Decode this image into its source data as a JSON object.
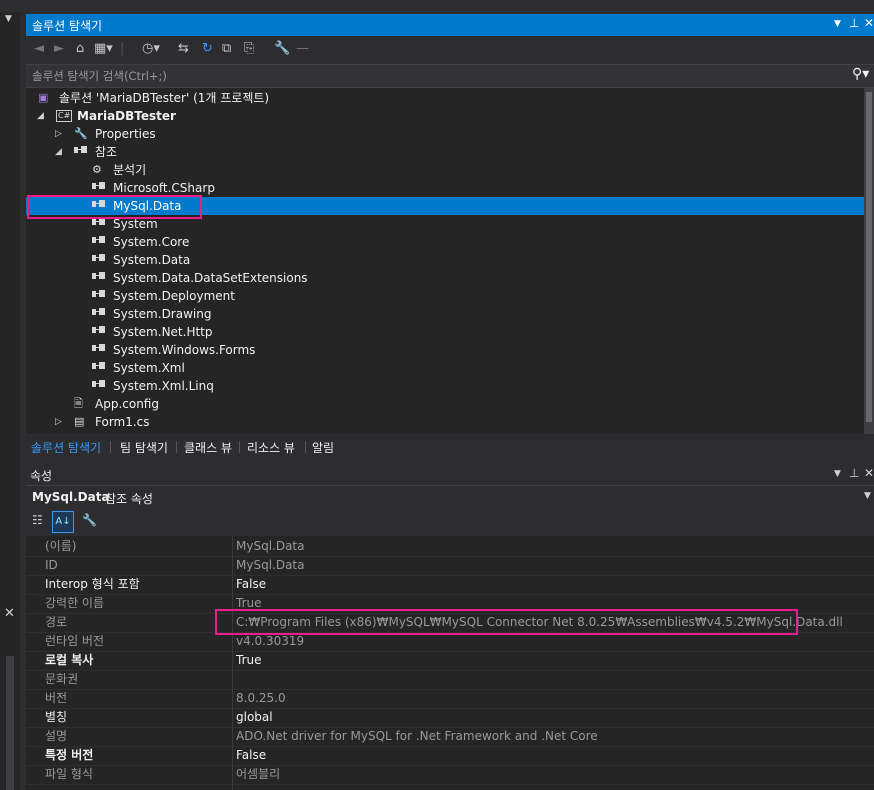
{
  "solution_explorer": {
    "title": "솔루션 탐색기",
    "search_placeholder": "솔루션 탐색기 검색(Ctrl+;)",
    "tree": [
      {
        "label": "솔루션 'MariaDBTester' (1개 프로젝트)",
        "icon": "solution-icon",
        "level": 0
      },
      {
        "label": "MariaDBTester",
        "icon": "csharp-project-icon",
        "level": 0,
        "expanded": true,
        "bold": true
      },
      {
        "label": "Properties",
        "icon": "wrench-icon",
        "level": 1,
        "collapsed": true
      },
      {
        "label": "참조",
        "icon": "reference-icon",
        "level": 1,
        "expanded": true
      },
      {
        "label": "분석기",
        "icon": "analyzer-icon",
        "level": 2
      },
      {
        "label": "Microsoft.CSharp",
        "icon": "reference-icon",
        "level": 2
      },
      {
        "label": "MySql.Data",
        "icon": "reference-icon",
        "level": 2,
        "selected": true
      },
      {
        "label": "System",
        "icon": "reference-icon",
        "level": 2
      },
      {
        "label": "System.Core",
        "icon": "reference-icon",
        "level": 2
      },
      {
        "label": "System.Data",
        "icon": "reference-icon",
        "level": 2
      },
      {
        "label": "System.Data.DataSetExtensions",
        "icon": "reference-icon",
        "level": 2
      },
      {
        "label": "System.Deployment",
        "icon": "reference-icon",
        "level": 2
      },
      {
        "label": "System.Drawing",
        "icon": "reference-icon",
        "level": 2
      },
      {
        "label": "System.Net.Http",
        "icon": "reference-icon",
        "level": 2
      },
      {
        "label": "System.Windows.Forms",
        "icon": "reference-icon",
        "level": 2
      },
      {
        "label": "System.Xml",
        "icon": "reference-icon",
        "level": 2
      },
      {
        "label": "System.Xml.Linq",
        "icon": "reference-icon",
        "level": 2
      },
      {
        "label": "App.config",
        "icon": "config-icon",
        "level": 1
      },
      {
        "label": "Form1.cs",
        "icon": "form-icon",
        "level": 1,
        "collapsed": true
      }
    ],
    "tabs": [
      "솔루션 탐색기",
      "팀 탐색기",
      "클래스 뷰",
      "리소스 뷰",
      "알림"
    ]
  },
  "properties": {
    "title": "속성",
    "object_name": "MySql.Data",
    "object_type": "참조 속성",
    "rows": [
      {
        "name": "(이름)",
        "value": "MySql.Data",
        "readonly": true
      },
      {
        "name": "ID",
        "value": "MySql.Data",
        "readonly": true
      },
      {
        "name": "Interop 형식 포함",
        "value": "False",
        "readonly": false
      },
      {
        "name": "강력한 이름",
        "value": "True",
        "readonly": true
      },
      {
        "name": "경로",
        "value": "C:₩Program Files (x86)₩MySQL₩MySQL Connector Net 8.0.25₩Assemblies₩v4.5.2₩MySql.Data.dll",
        "readonly": true
      },
      {
        "name": "런타임 버전",
        "value": "v4.0.30319",
        "readonly": true
      },
      {
        "name": "로컬 복사",
        "value": "True",
        "readonly": false,
        "bold": true
      },
      {
        "name": "문화권",
        "value": "",
        "readonly": true
      },
      {
        "name": "버전",
        "value": "8.0.25.0",
        "readonly": true
      },
      {
        "name": "별칭",
        "value": "global",
        "readonly": false
      },
      {
        "name": "설명",
        "value": "ADO.Net driver for MySQL for .Net Framework and .Net Core",
        "readonly": true
      },
      {
        "name": "특정 버전",
        "value": "False",
        "readonly": false,
        "bold": true
      },
      {
        "name": "파일 형식",
        "value": "어셈블리",
        "readonly": true
      }
    ]
  },
  "colors": {
    "accent": "#007acc",
    "highlight_box": "#ec1c8c"
  }
}
